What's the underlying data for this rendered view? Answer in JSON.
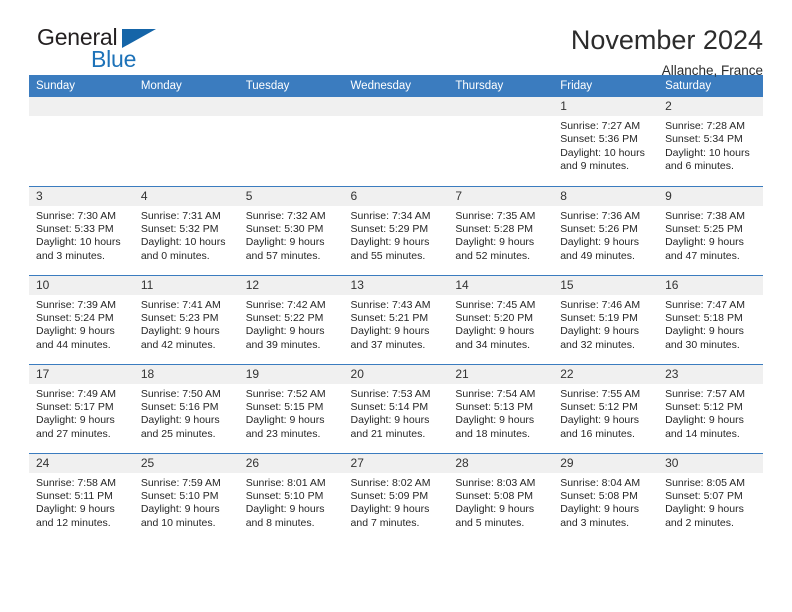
{
  "logo": {
    "word_one": "General",
    "word_two": "Blue",
    "triangle_color": "#1565a8",
    "blue_color": "#1d72b8"
  },
  "header": {
    "title": "November 2024",
    "subtitle": "Allanche, France"
  },
  "theme": {
    "header_blue": "#3b7cbf",
    "daynum_bg": "#f0f0f0"
  },
  "calendar": {
    "weekday_headers": [
      "Sunday",
      "Monday",
      "Tuesday",
      "Wednesday",
      "Thursday",
      "Friday",
      "Saturday"
    ],
    "weeks": [
      [
        {
          "empty": true,
          "day": ""
        },
        {
          "empty": true,
          "day": ""
        },
        {
          "empty": true,
          "day": ""
        },
        {
          "empty": true,
          "day": ""
        },
        {
          "empty": true,
          "day": ""
        },
        {
          "empty": false,
          "day": "1",
          "sunrise": "Sunrise: 7:27 AM",
          "sunset": "Sunset: 5:36 PM",
          "daylight_line1": "Daylight: 10 hours",
          "daylight_line2": "and 9 minutes."
        },
        {
          "empty": false,
          "day": "2",
          "sunrise": "Sunrise: 7:28 AM",
          "sunset": "Sunset: 5:34 PM",
          "daylight_line1": "Daylight: 10 hours",
          "daylight_line2": "and 6 minutes."
        }
      ],
      [
        {
          "empty": false,
          "day": "3",
          "sunrise": "Sunrise: 7:30 AM",
          "sunset": "Sunset: 5:33 PM",
          "daylight_line1": "Daylight: 10 hours",
          "daylight_line2": "and 3 minutes."
        },
        {
          "empty": false,
          "day": "4",
          "sunrise": "Sunrise: 7:31 AM",
          "sunset": "Sunset: 5:32 PM",
          "daylight_line1": "Daylight: 10 hours",
          "daylight_line2": "and 0 minutes."
        },
        {
          "empty": false,
          "day": "5",
          "sunrise": "Sunrise: 7:32 AM",
          "sunset": "Sunset: 5:30 PM",
          "daylight_line1": "Daylight: 9 hours",
          "daylight_line2": "and 57 minutes."
        },
        {
          "empty": false,
          "day": "6",
          "sunrise": "Sunrise: 7:34 AM",
          "sunset": "Sunset: 5:29 PM",
          "daylight_line1": "Daylight: 9 hours",
          "daylight_line2": "and 55 minutes."
        },
        {
          "empty": false,
          "day": "7",
          "sunrise": "Sunrise: 7:35 AM",
          "sunset": "Sunset: 5:28 PM",
          "daylight_line1": "Daylight: 9 hours",
          "daylight_line2": "and 52 minutes."
        },
        {
          "empty": false,
          "day": "8",
          "sunrise": "Sunrise: 7:36 AM",
          "sunset": "Sunset: 5:26 PM",
          "daylight_line1": "Daylight: 9 hours",
          "daylight_line2": "and 49 minutes."
        },
        {
          "empty": false,
          "day": "9",
          "sunrise": "Sunrise: 7:38 AM",
          "sunset": "Sunset: 5:25 PM",
          "daylight_line1": "Daylight: 9 hours",
          "daylight_line2": "and 47 minutes."
        }
      ],
      [
        {
          "empty": false,
          "day": "10",
          "sunrise": "Sunrise: 7:39 AM",
          "sunset": "Sunset: 5:24 PM",
          "daylight_line1": "Daylight: 9 hours",
          "daylight_line2": "and 44 minutes."
        },
        {
          "empty": false,
          "day": "11",
          "sunrise": "Sunrise: 7:41 AM",
          "sunset": "Sunset: 5:23 PM",
          "daylight_line1": "Daylight: 9 hours",
          "daylight_line2": "and 42 minutes."
        },
        {
          "empty": false,
          "day": "12",
          "sunrise": "Sunrise: 7:42 AM",
          "sunset": "Sunset: 5:22 PM",
          "daylight_line1": "Daylight: 9 hours",
          "daylight_line2": "and 39 minutes."
        },
        {
          "empty": false,
          "day": "13",
          "sunrise": "Sunrise: 7:43 AM",
          "sunset": "Sunset: 5:21 PM",
          "daylight_line1": "Daylight: 9 hours",
          "daylight_line2": "and 37 minutes."
        },
        {
          "empty": false,
          "day": "14",
          "sunrise": "Sunrise: 7:45 AM",
          "sunset": "Sunset: 5:20 PM",
          "daylight_line1": "Daylight: 9 hours",
          "daylight_line2": "and 34 minutes."
        },
        {
          "empty": false,
          "day": "15",
          "sunrise": "Sunrise: 7:46 AM",
          "sunset": "Sunset: 5:19 PM",
          "daylight_line1": "Daylight: 9 hours",
          "daylight_line2": "and 32 minutes."
        },
        {
          "empty": false,
          "day": "16",
          "sunrise": "Sunrise: 7:47 AM",
          "sunset": "Sunset: 5:18 PM",
          "daylight_line1": "Daylight: 9 hours",
          "daylight_line2": "and 30 minutes."
        }
      ],
      [
        {
          "empty": false,
          "day": "17",
          "sunrise": "Sunrise: 7:49 AM",
          "sunset": "Sunset: 5:17 PM",
          "daylight_line1": "Daylight: 9 hours",
          "daylight_line2": "and 27 minutes."
        },
        {
          "empty": false,
          "day": "18",
          "sunrise": "Sunrise: 7:50 AM",
          "sunset": "Sunset: 5:16 PM",
          "daylight_line1": "Daylight: 9 hours",
          "daylight_line2": "and 25 minutes."
        },
        {
          "empty": false,
          "day": "19",
          "sunrise": "Sunrise: 7:52 AM",
          "sunset": "Sunset: 5:15 PM",
          "daylight_line1": "Daylight: 9 hours",
          "daylight_line2": "and 23 minutes."
        },
        {
          "empty": false,
          "day": "20",
          "sunrise": "Sunrise: 7:53 AM",
          "sunset": "Sunset: 5:14 PM",
          "daylight_line1": "Daylight: 9 hours",
          "daylight_line2": "and 21 minutes."
        },
        {
          "empty": false,
          "day": "21",
          "sunrise": "Sunrise: 7:54 AM",
          "sunset": "Sunset: 5:13 PM",
          "daylight_line1": "Daylight: 9 hours",
          "daylight_line2": "and 18 minutes."
        },
        {
          "empty": false,
          "day": "22",
          "sunrise": "Sunrise: 7:55 AM",
          "sunset": "Sunset: 5:12 PM",
          "daylight_line1": "Daylight: 9 hours",
          "daylight_line2": "and 16 minutes."
        },
        {
          "empty": false,
          "day": "23",
          "sunrise": "Sunrise: 7:57 AM",
          "sunset": "Sunset: 5:12 PM",
          "daylight_line1": "Daylight: 9 hours",
          "daylight_line2": "and 14 minutes."
        }
      ],
      [
        {
          "empty": false,
          "day": "24",
          "sunrise": "Sunrise: 7:58 AM",
          "sunset": "Sunset: 5:11 PM",
          "daylight_line1": "Daylight: 9 hours",
          "daylight_line2": "and 12 minutes."
        },
        {
          "empty": false,
          "day": "25",
          "sunrise": "Sunrise: 7:59 AM",
          "sunset": "Sunset: 5:10 PM",
          "daylight_line1": "Daylight: 9 hours",
          "daylight_line2": "and 10 minutes."
        },
        {
          "empty": false,
          "day": "26",
          "sunrise": "Sunrise: 8:01 AM",
          "sunset": "Sunset: 5:10 PM",
          "daylight_line1": "Daylight: 9 hours",
          "daylight_line2": "and 8 minutes."
        },
        {
          "empty": false,
          "day": "27",
          "sunrise": "Sunrise: 8:02 AM",
          "sunset": "Sunset: 5:09 PM",
          "daylight_line1": "Daylight: 9 hours",
          "daylight_line2": "and 7 minutes."
        },
        {
          "empty": false,
          "day": "28",
          "sunrise": "Sunrise: 8:03 AM",
          "sunset": "Sunset: 5:08 PM",
          "daylight_line1": "Daylight: 9 hours",
          "daylight_line2": "and 5 minutes."
        },
        {
          "empty": false,
          "day": "29",
          "sunrise": "Sunrise: 8:04 AM",
          "sunset": "Sunset: 5:08 PM",
          "daylight_line1": "Daylight: 9 hours",
          "daylight_line2": "and 3 minutes."
        },
        {
          "empty": false,
          "day": "30",
          "sunrise": "Sunrise: 8:05 AM",
          "sunset": "Sunset: 5:07 PM",
          "daylight_line1": "Daylight: 9 hours",
          "daylight_line2": "and 2 minutes."
        }
      ]
    ]
  }
}
